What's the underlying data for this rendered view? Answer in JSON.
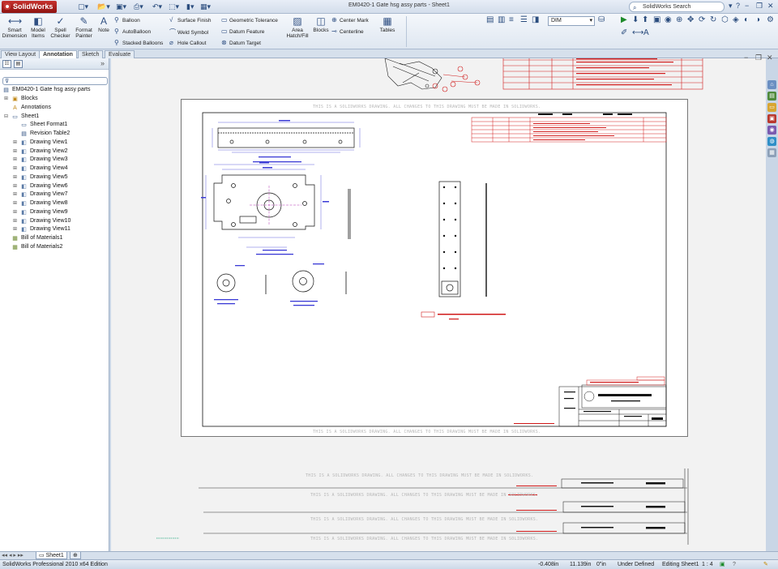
{
  "app": {
    "brand": "SolidWorks",
    "document_title": "EM0420-1 Gate hsg assy parts - Sheet1",
    "search_placeholder": "SolidWorks Search"
  },
  "ribbon": {
    "big_buttons": [
      "Smart Dimension",
      "Model Items",
      "Spell Checker",
      "Format Painter",
      "Note"
    ],
    "balloon_group": [
      "Balloon",
      "AutoBalloon",
      "Stacked Balloons"
    ],
    "symbol_group": [
      "Surface Finish",
      "Weld Symbol",
      "Hole Callout"
    ],
    "datum_group": [
      "Geometric Tolerance",
      "Datum Feature",
      "Datum Target"
    ],
    "area_hatch": "Area Hatch/Fill",
    "blocks": "Blocks",
    "center_group": [
      "Center Mark",
      "Centerline"
    ],
    "tables": "Tables",
    "layer_combo": "DIM"
  },
  "tabs": [
    "View Layout",
    "Annotation",
    "Sketch",
    "Evaluate"
  ],
  "active_tab": "Annotation",
  "tree": {
    "root": "EM0420-1 Gate hsg assy parts",
    "items": [
      {
        "label": "Blocks",
        "level": 1
      },
      {
        "label": "Annotations",
        "level": 1
      },
      {
        "label": "Sheet1",
        "level": 1
      },
      {
        "label": "Sheet Format1",
        "level": 2
      },
      {
        "label": "Revision Table2",
        "level": 2
      },
      {
        "label": "Drawing View1",
        "level": 2
      },
      {
        "label": "Drawing View2",
        "level": 2
      },
      {
        "label": "Drawing View3",
        "level": 2
      },
      {
        "label": "Drawing View4",
        "level": 2
      },
      {
        "label": "Drawing View5",
        "level": 2
      },
      {
        "label": "Drawing View6",
        "level": 2
      },
      {
        "label": "Drawing View7",
        "level": 2
      },
      {
        "label": "Drawing View8",
        "level": 2
      },
      {
        "label": "Drawing View9",
        "level": 2
      },
      {
        "label": "Drawing View10",
        "level": 2
      },
      {
        "label": "Drawing View11",
        "level": 2
      },
      {
        "label": "Bill of Materials1",
        "level": 1
      },
      {
        "label": "Bill of Materials2",
        "level": 1
      }
    ]
  },
  "drawing": {
    "watermark": "THIS IS A SOLIDWORKS DRAWING. ALL CHANGES TO THIS DRAWING MUST BE MADE IN SOLIDWORKS.",
    "company": "AUTOMATIC SYSTEMS INC.",
    "part_no_label": "P.N.",
    "rev_label": "REV."
  },
  "sheet_tabs": [
    "Sheet1"
  ],
  "status": {
    "edition": "SolidWorks Professional 2010 x64 Edition",
    "x": "-0.408in",
    "y": "11.139in",
    "z": "0\"in",
    "definition": "Under Defined",
    "editing": "Editing Sheet1",
    "scale": "1 : 4"
  },
  "colors": {
    "accent": "#2b4d7e",
    "annotation_red": "#d11a1a",
    "sketch_blue": "#3a3ad6",
    "ribbon_bg": "#dfe7f1"
  }
}
